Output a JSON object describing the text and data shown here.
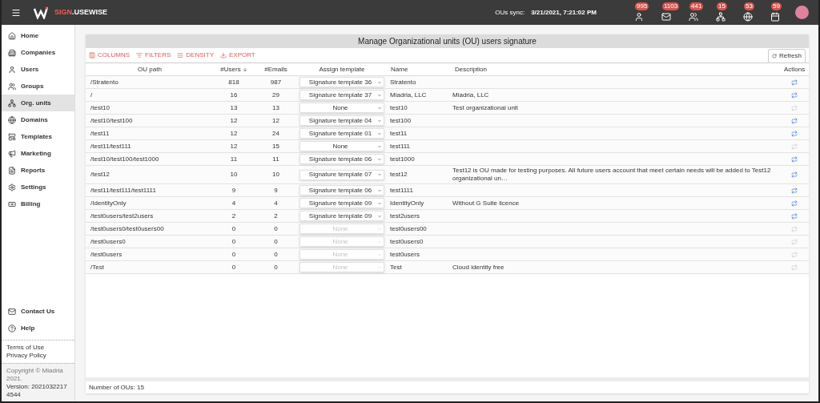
{
  "header": {
    "brand_primary": "SIGN",
    "brand_rest": ".USEWISE",
    "sync_label": "OUs sync:",
    "sync_time": "3/21/2021, 7:21:02 PM",
    "badges": [
      {
        "count": "995"
      },
      {
        "count": "1103"
      },
      {
        "count": "441"
      },
      {
        "count": "15"
      },
      {
        "count": "53"
      },
      {
        "count": "59"
      }
    ]
  },
  "sidebar": {
    "items": [
      {
        "label": "Home",
        "selected": false
      },
      {
        "label": "Companies",
        "selected": false
      },
      {
        "label": "Users",
        "selected": false
      },
      {
        "label": "Groups",
        "selected": false
      },
      {
        "label": "Org. units",
        "selected": true
      },
      {
        "label": "Domains",
        "selected": false
      },
      {
        "label": "Templates",
        "selected": false
      },
      {
        "label": "Marketing",
        "selected": false
      },
      {
        "label": "Reports",
        "selected": false
      },
      {
        "label": "Settings",
        "selected": false
      },
      {
        "label": "Billing",
        "selected": false
      }
    ],
    "bottom_items": [
      {
        "label": "Contact Us"
      },
      {
        "label": "Help"
      }
    ],
    "links": [
      "Terms of Use",
      "Privacy Policy"
    ],
    "copyright": "Copyright © Miadria 2021.",
    "version": "Version: 20210322174544"
  },
  "panel": {
    "title": "Manage Organizational units (OU) users signature",
    "toolbar": [
      "COLUMNS",
      "FILTERS",
      "DENSITY",
      "EXPORT"
    ],
    "refresh": "Refresh",
    "columns": [
      {
        "label": "OU path",
        "sorted": false
      },
      {
        "label": "#Users",
        "sorted": true
      },
      {
        "label": "#Emails",
        "sorted": false
      },
      {
        "label": "Assign template",
        "sorted": false
      },
      {
        "label": "Name",
        "sorted": false
      },
      {
        "label": "Description",
        "sorted": false
      },
      {
        "label": "Actions",
        "sorted": false
      }
    ],
    "rows": [
      {
        "path": "/Stratento",
        "users": "818",
        "emails": "987",
        "template": "Signature template 36",
        "template_disabled": false,
        "name": "Stratento",
        "description": "",
        "sync_disabled": false
      },
      {
        "path": "/",
        "users": "16",
        "emails": "29",
        "template": "Signature template 37",
        "template_disabled": false,
        "name": "Miadria, LLC",
        "description": "Miadria, LLC",
        "sync_disabled": false
      },
      {
        "path": "/test10",
        "users": "13",
        "emails": "13",
        "template": "None",
        "template_disabled": false,
        "name": "test10",
        "description": "Test organizational unit",
        "sync_disabled": true
      },
      {
        "path": "/test10/test100",
        "users": "12",
        "emails": "12",
        "template": "Signature template 04",
        "template_disabled": false,
        "name": "test100",
        "description": "",
        "sync_disabled": false
      },
      {
        "path": "/test11",
        "users": "12",
        "emails": "24",
        "template": "Signature template 01",
        "template_disabled": false,
        "name": "test11",
        "description": "",
        "sync_disabled": false
      },
      {
        "path": "/test11/test111",
        "users": "12",
        "emails": "15",
        "template": "None",
        "template_disabled": false,
        "name": "test111",
        "description": "",
        "sync_disabled": true
      },
      {
        "path": "/test10/test100/test1000",
        "users": "11",
        "emails": "11",
        "template": "Signature template 06",
        "template_disabled": false,
        "name": "test1000",
        "description": "",
        "sync_disabled": false
      },
      {
        "path": "/test12",
        "users": "10",
        "emails": "10",
        "template": "Signature template 07",
        "template_disabled": false,
        "name": "test12",
        "description": "Test12 is OU made for testing purposes. All future users account that meet certain needs will be added to Test12 organizational un…",
        "sync_disabled": false
      },
      {
        "path": "/test11/test111/test1111",
        "users": "9",
        "emails": "9",
        "template": "Signature template 06",
        "template_disabled": false,
        "name": "test1111",
        "description": "",
        "sync_disabled": false
      },
      {
        "path": "/IdentityOnly",
        "users": "4",
        "emails": "4",
        "template": "Signature template 09",
        "template_disabled": false,
        "name": "IdentityOnly",
        "description": "Without G Suite licence",
        "sync_disabled": false
      },
      {
        "path": "/test0users/test2users",
        "users": "2",
        "emails": "2",
        "template": "Signature template 09",
        "template_disabled": false,
        "name": "test2users",
        "description": "",
        "sync_disabled": false
      },
      {
        "path": "/test0users0/test0users00",
        "users": "0",
        "emails": "0",
        "template": "None",
        "template_disabled": true,
        "name": "test0users00",
        "description": "",
        "sync_disabled": true
      },
      {
        "path": "/test0users0",
        "users": "0",
        "emails": "0",
        "template": "None",
        "template_disabled": true,
        "name": "test0users0",
        "description": "",
        "sync_disabled": true
      },
      {
        "path": "/test0users",
        "users": "0",
        "emails": "0",
        "template": "None",
        "template_disabled": true,
        "name": "test0users",
        "description": "",
        "sync_disabled": true
      },
      {
        "path": "/Test",
        "users": "0",
        "emails": "0",
        "template": "None",
        "template_disabled": true,
        "name": "Test",
        "description": "Cloud identity free",
        "sync_disabled": true
      }
    ],
    "footer": "Number of OUs: 15"
  }
}
